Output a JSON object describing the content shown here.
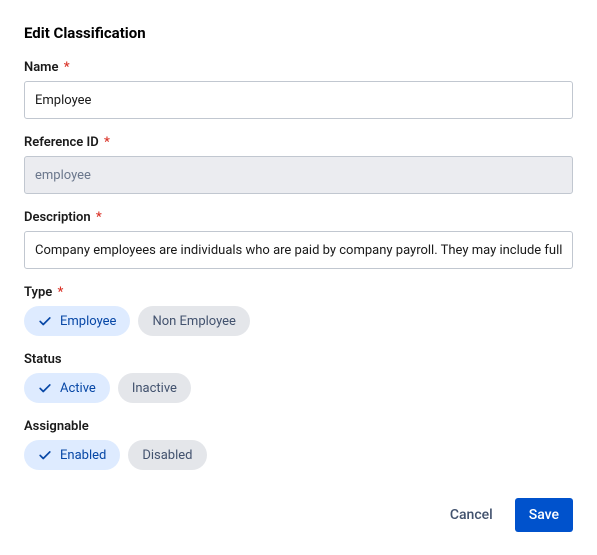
{
  "title": "Edit Classification",
  "fields": {
    "name": {
      "label": "Name",
      "value": "Employee",
      "required": true
    },
    "referenceId": {
      "label": "Reference ID",
      "value": "employee",
      "required": true,
      "disabled": true
    },
    "description": {
      "label": "Description",
      "value": "Company employees are individuals who are paid by company payroll. They may include full",
      "required": true
    },
    "type": {
      "label": "Type",
      "required": true,
      "options": {
        "selected": "Employee",
        "unselected": "Non Employee"
      }
    },
    "status": {
      "label": "Status",
      "required": false,
      "options": {
        "selected": "Active",
        "unselected": "Inactive"
      }
    },
    "assignable": {
      "label": "Assignable",
      "required": false,
      "options": {
        "selected": "Enabled",
        "unselected": "Disabled"
      }
    }
  },
  "buttons": {
    "cancel": "Cancel",
    "save": "Save"
  },
  "asterisk": "*"
}
